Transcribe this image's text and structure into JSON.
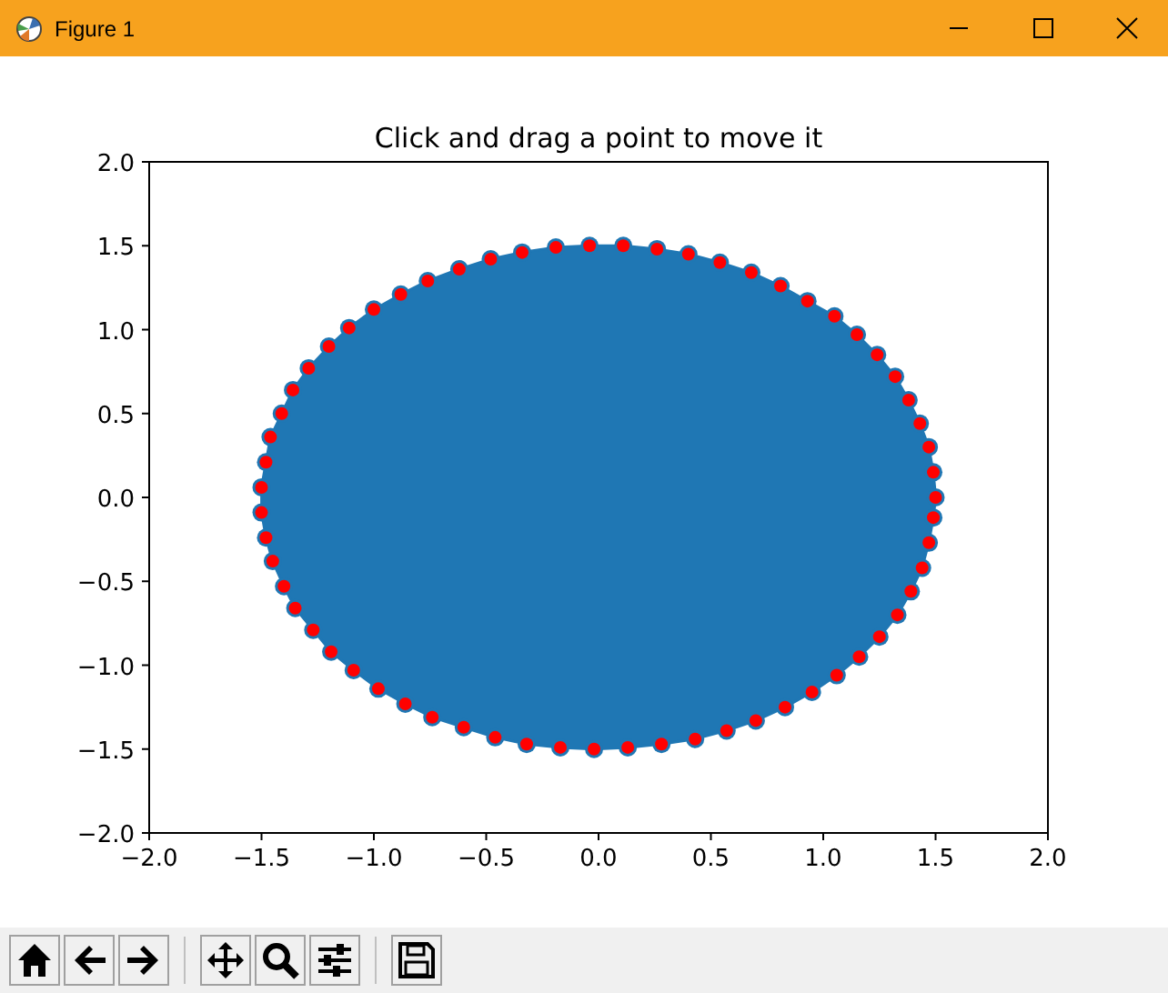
{
  "window": {
    "title": "Figure 1"
  },
  "chart": {
    "chart_data": {
      "type": "area",
      "title": "Click and drag a point to move it",
      "x": [
        1.5,
        1.49,
        1.47,
        1.43,
        1.38,
        1.32,
        1.24,
        1.15,
        1.05,
        0.93,
        0.81,
        0.68,
        0.54,
        0.4,
        0.26,
        0.11,
        -0.04,
        -0.19,
        -0.34,
        -0.48,
        -0.62,
        -0.76,
        -0.88,
        -1.0,
        -1.11,
        -1.2,
        -1.29,
        -1.36,
        -1.41,
        -1.46,
        -1.48,
        -1.5,
        -1.5,
        -1.48,
        -1.45,
        -1.4,
        -1.35,
        -1.27,
        -1.19,
        -1.09,
        -0.98,
        -0.86,
        -0.74,
        -0.6,
        -0.46,
        -0.32,
        -0.17,
        -0.02,
        0.13,
        0.28,
        0.43,
        0.57,
        0.7,
        0.83,
        0.95,
        1.06,
        1.16,
        1.25,
        1.33,
        1.39,
        1.44,
        1.47,
        1.49
      ],
      "series": [
        {
          "color": "#1f77b4",
          "values": [
            0,
            0.15,
            0.3,
            0.44,
            0.58,
            0.72,
            0.85,
            0.97,
            1.08,
            1.17,
            1.26,
            1.34,
            1.4,
            1.45,
            1.48,
            1.5,
            1.5,
            1.49,
            1.46,
            1.42,
            1.36,
            1.29,
            1.21,
            1.12,
            1.01,
            0.9,
            0.77,
            0.64,
            0.5,
            0.36,
            0.21,
            0.06,
            -0.09,
            -0.24,
            -0.38,
            -0.53,
            -0.66,
            -0.79,
            -0.92,
            -1.03,
            -1.14,
            -1.23,
            -1.31,
            -1.37,
            -1.43,
            -1.47,
            -1.49,
            -1.5,
            -1.49,
            -1.47,
            -1.44,
            -1.39,
            -1.33,
            -1.25,
            -1.16,
            -1.06,
            -0.95,
            -0.83,
            -0.7,
            -0.56,
            -0.42,
            -0.27,
            -0.12
          ]
        }
      ],
      "xlim": [
        -2,
        2
      ],
      "ylim": [
        -2,
        2
      ],
      "xticks": [
        {
          "value": -2,
          "label": "−2.0"
        },
        {
          "value": -1.5,
          "label": "−1.5"
        },
        {
          "value": -1,
          "label": "−1.0"
        },
        {
          "value": -0.5,
          "label": "−0.5"
        },
        {
          "value": 0,
          "label": "0.0"
        },
        {
          "value": 0.5,
          "label": "0.5"
        },
        {
          "value": 1,
          "label": "1.0"
        },
        {
          "value": 1.5,
          "label": "1.5"
        },
        {
          "value": 2,
          "label": "2.0"
        }
      ],
      "yticks": [
        {
          "value": -2,
          "label": "−2.0"
        },
        {
          "value": -1.5,
          "label": "−1.5"
        },
        {
          "value": -1,
          "label": "−1.0"
        },
        {
          "value": -0.5,
          "label": "−0.5"
        },
        {
          "value": 0,
          "label": "0.0"
        },
        {
          "value": 0.5,
          "label": "0.5"
        },
        {
          "value": 1,
          "label": "1.0"
        },
        {
          "value": 1.5,
          "label": "1.5"
        },
        {
          "value": 2,
          "label": "2.0"
        }
      ]
    }
  }
}
